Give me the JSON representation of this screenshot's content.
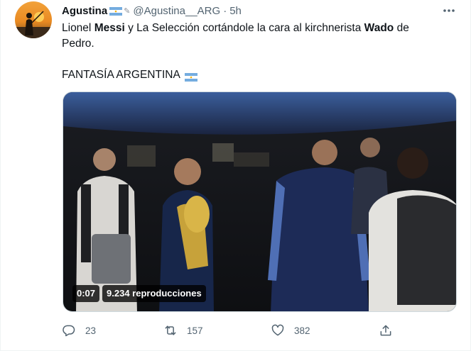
{
  "tweet": {
    "author_name": "Agustina",
    "author_handle": "@Agustina__ARG",
    "separator": "·",
    "time": "5h",
    "text": {
      "p1": "Lionel ",
      "b1": "Messi",
      "p2": " y La Selección cortándole la cara al kirchnerista ",
      "b2": "Wado",
      "p3": " de",
      "line2": "Pedro.",
      "line3": "FANTASÍA ARGENTINA"
    },
    "video": {
      "duration": "0:07",
      "views": "9.234 reproducciones"
    },
    "actions": {
      "reply_count": "23",
      "retweet_count": "157",
      "like_count": "382"
    },
    "icons": {
      "more": "more-icon",
      "reply": "reply-icon",
      "retweet": "retweet-icon",
      "like": "heart-icon",
      "share": "share-icon",
      "flag": "argentina-flag-icon"
    },
    "colors": {
      "flag_blue": "#74acdf",
      "flag_white": "#ffffff",
      "flag_sun": "#f6b40e",
      "secondary_text": "#536471"
    }
  }
}
